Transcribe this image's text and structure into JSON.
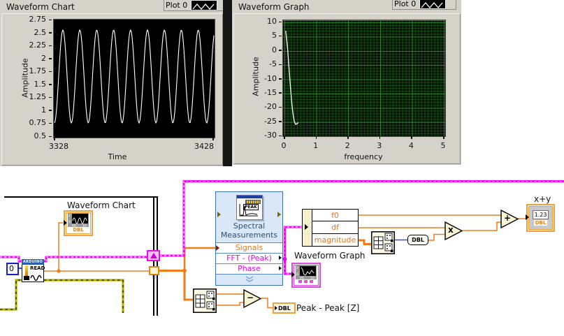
{
  "front_panel": {
    "waveform_chart": {
      "title": "Waveform Chart",
      "legend": {
        "label": "Plot 0"
      },
      "y_axis": {
        "label": "Amplitude",
        "ticks": [
          "2.75",
          "2.5",
          "2.25",
          "2",
          "1.75",
          "1.5",
          "1.25",
          "1",
          "0.75",
          "0.5"
        ]
      },
      "x_axis": {
        "label": "Time",
        "ticks": [
          "3328",
          "3428"
        ]
      }
    },
    "waveform_graph": {
      "title": "Waveform Graph",
      "legend": {
        "label": "Plot 0"
      },
      "y_axis": {
        "label": "Amplitude",
        "ticks": [
          "10",
          "5",
          "0",
          "-5",
          "-10",
          "-15",
          "-20",
          "-25",
          "-30"
        ]
      },
      "x_axis": {
        "label": "frequency",
        "ticks": [
          "0",
          "1",
          "2",
          "3",
          "4",
          "5"
        ]
      }
    }
  },
  "chart_data": [
    {
      "type": "line",
      "title": "Waveform Chart",
      "xlabel": "Time",
      "ylabel": "Amplitude",
      "xlim": [
        3328,
        3428
      ],
      "ylim": [
        0.5,
        2.75
      ],
      "grid": false,
      "plot_bg": "#000000",
      "line_color": "#FFFFFF",
      "legend": [
        "Plot 0"
      ],
      "series": [
        {
          "name": "Plot 0",
          "waveform": "sine",
          "cycles_visible": 9.5,
          "y_min": 0.78,
          "y_max": 2.55,
          "phase_rad": -1.8
        }
      ]
    },
    {
      "type": "line",
      "title": "Waveform Graph",
      "xlabel": "frequency",
      "ylabel": "Amplitude",
      "xlim": [
        0,
        5
      ],
      "ylim": [
        -30,
        10
      ],
      "grid": true,
      "plot_bg": "#061406",
      "grid_color": "#2C7A2C",
      "line_color": "#FFFFFF",
      "legend": [
        "Plot 0"
      ],
      "series": [
        {
          "name": "Plot 0",
          "points": [
            [
              0.04,
              7
            ],
            [
              0.07,
              4
            ],
            [
              0.1,
              0.5
            ],
            [
              0.13,
              -4
            ],
            [
              0.16,
              -8.5
            ],
            [
              0.19,
              -13
            ],
            [
              0.22,
              -17
            ],
            [
              0.25,
              -20.5
            ],
            [
              0.28,
              -23
            ],
            [
              0.31,
              -24.8
            ],
            [
              0.35,
              -25.8
            ],
            [
              0.4,
              -25.6
            ],
            [
              0.43,
              -25.2
            ]
          ]
        }
      ]
    }
  ],
  "diagram": {
    "chart_terminal": {
      "label": "Waveform Chart",
      "type": "DBL"
    },
    "graph_terminal": {
      "label": "Waveform Graph"
    },
    "arduino_read": {
      "header": "ARDUINO",
      "label": "READ",
      "channel_constant": "0"
    },
    "spectral": {
      "icon_text": "PEAK",
      "title_line1": "Spectral",
      "title_line2": "Measurements",
      "rows": [
        {
          "label": "Signals"
        },
        {
          "label": "FFT - (Peak)"
        },
        {
          "label": "Phase"
        }
      ]
    },
    "unbundle": {
      "rows": [
        "f0",
        "df",
        "magnitude"
      ]
    },
    "index_tunnel": "[]",
    "ops": {
      "subtract": "−",
      "multiply": "x",
      "add": "+"
    },
    "dbl_conversion": "DBL",
    "peak_indicator": {
      "type": "DBL",
      "label": "Peak - Peak [Z]"
    },
    "xy_indicator": {
      "label": "x+y",
      "value": "1.23",
      "type": "DBL"
    }
  },
  "colors": {
    "panel_gray": "#D5D2CA",
    "wire_orange": "#EF7D1A",
    "wire_blue": "#2F4FD0",
    "wire_magenta": "#F000F0",
    "wire_error": "#B5B500",
    "terminal_orange": "#F0A03C",
    "terminal_pink": "#E248E2",
    "express_fill": "#D9E8F8",
    "express_border": "#3E6FAF",
    "row_signal_text": "#E87817",
    "row_fft_text": "#F000F0",
    "graph_grid": "#2C7A2C"
  }
}
